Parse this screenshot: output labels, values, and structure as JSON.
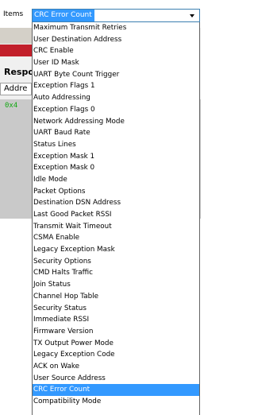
{
  "items_label": "Items",
  "combo": {
    "selected": "CRC Error Count"
  },
  "background": {
    "response_label": "Respo",
    "address_field": "Addre",
    "hex_value": "0x4"
  },
  "dropdown": {
    "selected_index": 34,
    "options": [
      "Maximum Transmit Retries",
      "User Destination Address",
      "CRC Enable",
      "User ID Mask",
      "UART Byte Count Trigger",
      "Exception Flags 1",
      "Auto Addressing",
      "Exception Flags 0",
      "Network Addressing Mode",
      "UART Baud Rate",
      "Status Lines",
      "Exception Mask 1",
      "Exception Mask 0",
      "Idle Mode",
      "Packet Options",
      "Destination DSN Address",
      "Last Good Packet RSSI",
      "Transmit Wait Timeout",
      "CSMA Enable",
      "Legacy Exception Mask",
      "Security Options",
      "CMD Halts Traffic",
      "Join Status",
      "Channel Hop Table",
      "Security Status",
      "Immediate RSSI",
      "Firmware Version",
      "TX Output Power Mode",
      "Legacy Exception Code",
      "ACK on Wake",
      "User Source Address",
      "CRC Error Count",
      "Compatibility Mode"
    ]
  },
  "colors": {
    "selection": "#3399ff",
    "red_bar": "#c21f2a",
    "hex_text": "#14a814"
  }
}
